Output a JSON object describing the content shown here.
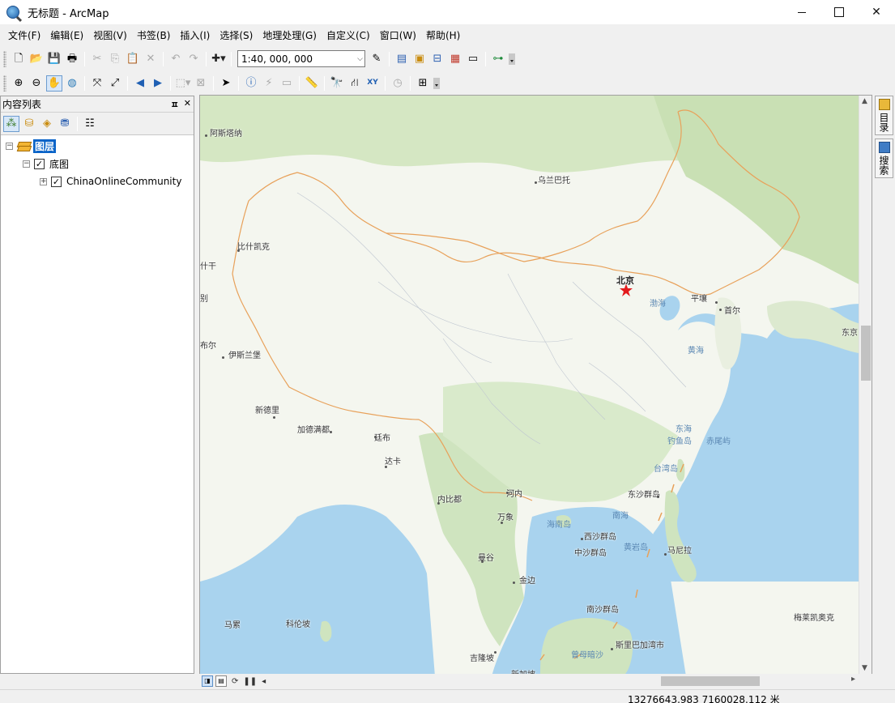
{
  "window": {
    "app_icon": "arcmap-globe-icon",
    "title": "无标题 - ArcMap",
    "minimize": "minimize-icon",
    "maximize": "maximize-icon",
    "close_glyph": "✕"
  },
  "menu": [
    "文件(F)",
    "编辑(E)",
    "视图(V)",
    "书签(B)",
    "插入(I)",
    "选择(S)",
    "地理处理(G)",
    "自定义(C)",
    "窗口(W)",
    "帮助(H)"
  ],
  "toolbar1": {
    "scale": "1:40, 000, 000",
    "icons": [
      "new-document-icon",
      "open-folder-icon",
      "save-icon",
      "print-icon",
      "cut-icon",
      "copy-icon",
      "paste-icon",
      "delete-icon",
      "undo-icon",
      "redo-icon",
      "add-data-icon",
      "editor-icon",
      "table-window-icon",
      "arctoolbox-icon",
      "catalog-icon",
      "search-window-icon",
      "python-icon",
      "model-builder-icon"
    ]
  },
  "toolbar2": {
    "icons": [
      "zoom-in-icon",
      "zoom-out-icon",
      "pan-icon",
      "full-extent-icon",
      "fixed-zoom-in-icon",
      "fixed-zoom-out-icon",
      "back-extent-icon",
      "forward-extent-icon",
      "select-features-icon",
      "clear-selection-icon",
      "select-elements-icon",
      "identify-icon",
      "hyperlink-icon",
      "html-popup-icon",
      "measure-icon",
      "find-icon",
      "find-route-icon",
      "go-to-xy-icon",
      "time-slider-icon",
      "create-viewer-window-icon"
    ]
  },
  "toc": {
    "title": "内容列表",
    "pin": "ㅍ",
    "close": "✕",
    "tools": [
      "list-by-drawing-order-icon",
      "list-by-source-icon",
      "list-by-visibility-icon",
      "list-by-selection-icon",
      "options-icon"
    ],
    "root": "图层",
    "group": "底图",
    "layer": "ChinaOnlineCommunity",
    "expand_minus": "−",
    "expand_plus": "+",
    "check": "✓"
  },
  "map": {
    "labels": [
      {
        "text": "阿斯塔纳",
        "cls": ""
      },
      {
        "text": "乌兰巴托",
        "cls": ""
      },
      {
        "text": "比什凯克",
        "cls": ""
      },
      {
        "text": "什干",
        "cls": ""
      },
      {
        "text": "北京",
        "cls": "big"
      },
      {
        "text": "渤海",
        "cls": "sea"
      },
      {
        "text": "平壤",
        "cls": ""
      },
      {
        "text": "首尔",
        "cls": ""
      },
      {
        "text": "黄海",
        "cls": "sea"
      },
      {
        "text": "东京",
        "cls": ""
      },
      {
        "text": "伊斯兰堡",
        "cls": ""
      },
      {
        "text": "布尔",
        "cls": ""
      },
      {
        "text": "别",
        "cls": ""
      },
      {
        "text": "新德里",
        "cls": ""
      },
      {
        "text": "加德满都",
        "cls": ""
      },
      {
        "text": "廷布",
        "cls": ""
      },
      {
        "text": "达卡",
        "cls": ""
      },
      {
        "text": "东海",
        "cls": "sea"
      },
      {
        "text": "钓鱼岛",
        "cls": "sea"
      },
      {
        "text": "赤尾屿",
        "cls": "sea"
      },
      {
        "text": "台湾岛",
        "cls": "sea"
      },
      {
        "text": "内比都",
        "cls": ""
      },
      {
        "text": "河内",
        "cls": ""
      },
      {
        "text": "东沙群岛",
        "cls": ""
      },
      {
        "text": "万象",
        "cls": ""
      },
      {
        "text": "海南岛",
        "cls": "sea"
      },
      {
        "text": "南海",
        "cls": "sea"
      },
      {
        "text": "西沙群岛",
        "cls": ""
      },
      {
        "text": "中沙群岛",
        "cls": ""
      },
      {
        "text": "黄岩岛",
        "cls": "sea"
      },
      {
        "text": "马尼拉",
        "cls": ""
      },
      {
        "text": "曼谷",
        "cls": ""
      },
      {
        "text": "金边",
        "cls": ""
      },
      {
        "text": "南沙群岛",
        "cls": ""
      },
      {
        "text": "马累",
        "cls": ""
      },
      {
        "text": "科伦坡",
        "cls": ""
      },
      {
        "text": "梅莱凯奥克",
        "cls": ""
      },
      {
        "text": "斯里巴加湾市",
        "cls": ""
      },
      {
        "text": "吉隆坡",
        "cls": ""
      },
      {
        "text": "曾母暗沙",
        "cls": "sea"
      },
      {
        "text": "新加坡",
        "cls": ""
      }
    ]
  },
  "dock": [
    "目录",
    "搜索"
  ],
  "status": {
    "coords": "13276643.983  7160028.112 米"
  },
  "colors": {
    "land": "#f4f6ef",
    "green": "#cfe4bf",
    "water": "#a9d3ee",
    "border": "#e8a15a",
    "selection": "#0a64c8"
  }
}
